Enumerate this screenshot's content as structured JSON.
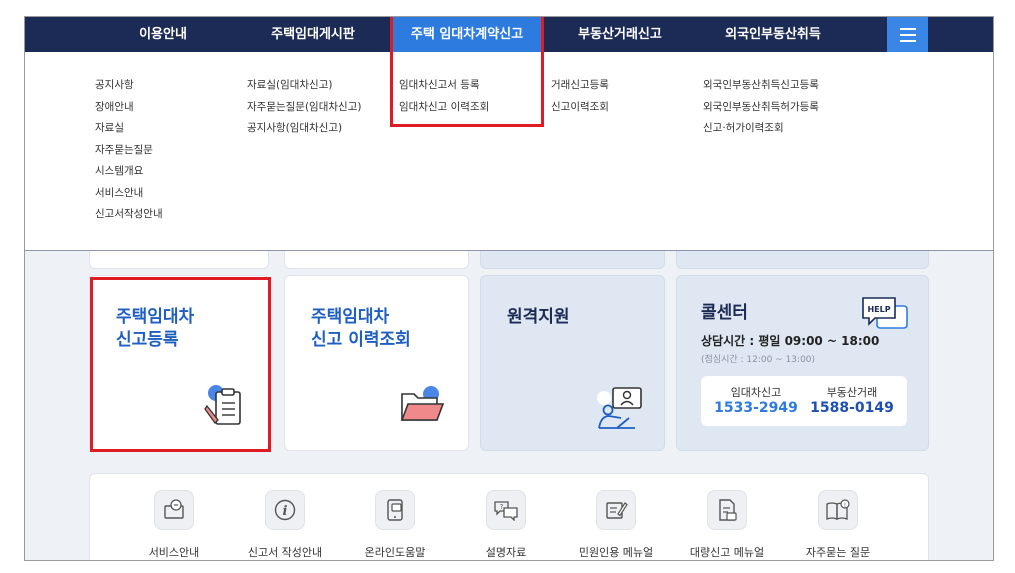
{
  "nav": {
    "items": [
      {
        "label": "이용안내"
      },
      {
        "label": "주택임대게시판"
      },
      {
        "label": "주택 임대차계약신고"
      },
      {
        "label": "부동산거래신고"
      },
      {
        "label": "외국인부동산취득"
      }
    ],
    "accent": "#2e7be0",
    "background": "#1c2b55"
  },
  "dropdown": {
    "col1": [
      "공지사항",
      "장애안내",
      "자료실",
      "자주묻는질문",
      "시스템개요",
      "서비스안내",
      "신고서작성안내"
    ],
    "col2": [
      "자료실(임대차신고)",
      "자주묻는질문(임대차신고)",
      "공지사항(임대차신고)"
    ],
    "col3": [
      "임대차신고서 등록",
      "임대차신고 이력조회"
    ],
    "col4": [
      "거래신고등록",
      "신고이력조회"
    ],
    "col5": [
      "외국인부동산취득신고등록",
      "외국인부동산취득허가등록",
      "신고·허가이력조회"
    ]
  },
  "cards": {
    "register": {
      "line1": "주택임대차",
      "line2": "신고등록"
    },
    "history": {
      "line1": "주택임대차",
      "line2": "신고 이력조회"
    },
    "remote": {
      "title": "원격지원"
    },
    "callcenter": {
      "title": "콜센터",
      "help_badge": "HELP",
      "hours": "상담시간 : 평일 09:00 ~ 18:00",
      "lunch": "(점심시간 : 12:00 ~ 13:00)",
      "lease_label": "임대차신고",
      "lease_phone": "1533-2949",
      "realty_label": "부동산거래",
      "realty_phone": "1588-0149"
    }
  },
  "quick": [
    {
      "label": "서비스안내",
      "icon": "service-guide-icon"
    },
    {
      "label": "신고서 작성안내",
      "icon": "info-icon"
    },
    {
      "label": "온라인도움말",
      "icon": "online-help-icon"
    },
    {
      "label": "설명자료",
      "icon": "explain-icon"
    },
    {
      "label": "민원인용 메뉴얼",
      "icon": "manual-icon"
    },
    {
      "label": "대량신고 메뉴얼",
      "icon": "bulk-manual-icon"
    },
    {
      "label": "자주묻는 질문",
      "icon": "faq-book-icon"
    }
  ],
  "highlight_color": "#e01b24"
}
